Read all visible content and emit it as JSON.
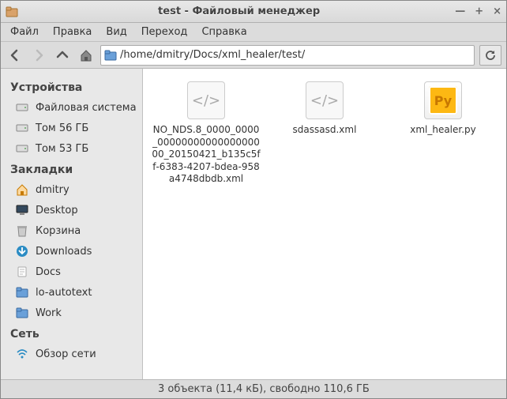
{
  "window": {
    "title": "test - Файловый менеджер"
  },
  "menu": {
    "file": "Файл",
    "edit": "Правка",
    "view": "Вид",
    "go": "Переход",
    "help": "Справка"
  },
  "path": "/home/dmitry/Docs/xml_healer/test/",
  "sidebar": {
    "devices": {
      "header": "Устройства",
      "items": [
        {
          "label": "Файловая система",
          "icon": "drive"
        },
        {
          "label": "Том 56 ГБ",
          "icon": "drive"
        },
        {
          "label": "Том 53 ГБ",
          "icon": "drive"
        }
      ]
    },
    "bookmarks": {
      "header": "Закладки",
      "items": [
        {
          "label": "dmitry",
          "icon": "home"
        },
        {
          "label": "Desktop",
          "icon": "desktop"
        },
        {
          "label": "Корзина",
          "icon": "trash"
        },
        {
          "label": "Downloads",
          "icon": "downloads"
        },
        {
          "label": "Docs",
          "icon": "folder"
        },
        {
          "label": "lo-autotext",
          "icon": "folder-blue"
        },
        {
          "label": "Work",
          "icon": "folder-blue"
        }
      ]
    },
    "network": {
      "header": "Сеть",
      "items": [
        {
          "label": "Обзор сети",
          "icon": "wifi"
        }
      ]
    }
  },
  "files": [
    {
      "name": "NO_NDS.8_0000_0000_0000000000000000000_20150421_b135c5ff-6383-4207-bdea-958a4748dbdb.xml",
      "type": "xml"
    },
    {
      "name": "sdassasd.xml",
      "type": "xml"
    },
    {
      "name": "xml_healer.py",
      "type": "py"
    }
  ],
  "status": "3 объекта (11,4 кБ), свободно 110,6 ГБ"
}
